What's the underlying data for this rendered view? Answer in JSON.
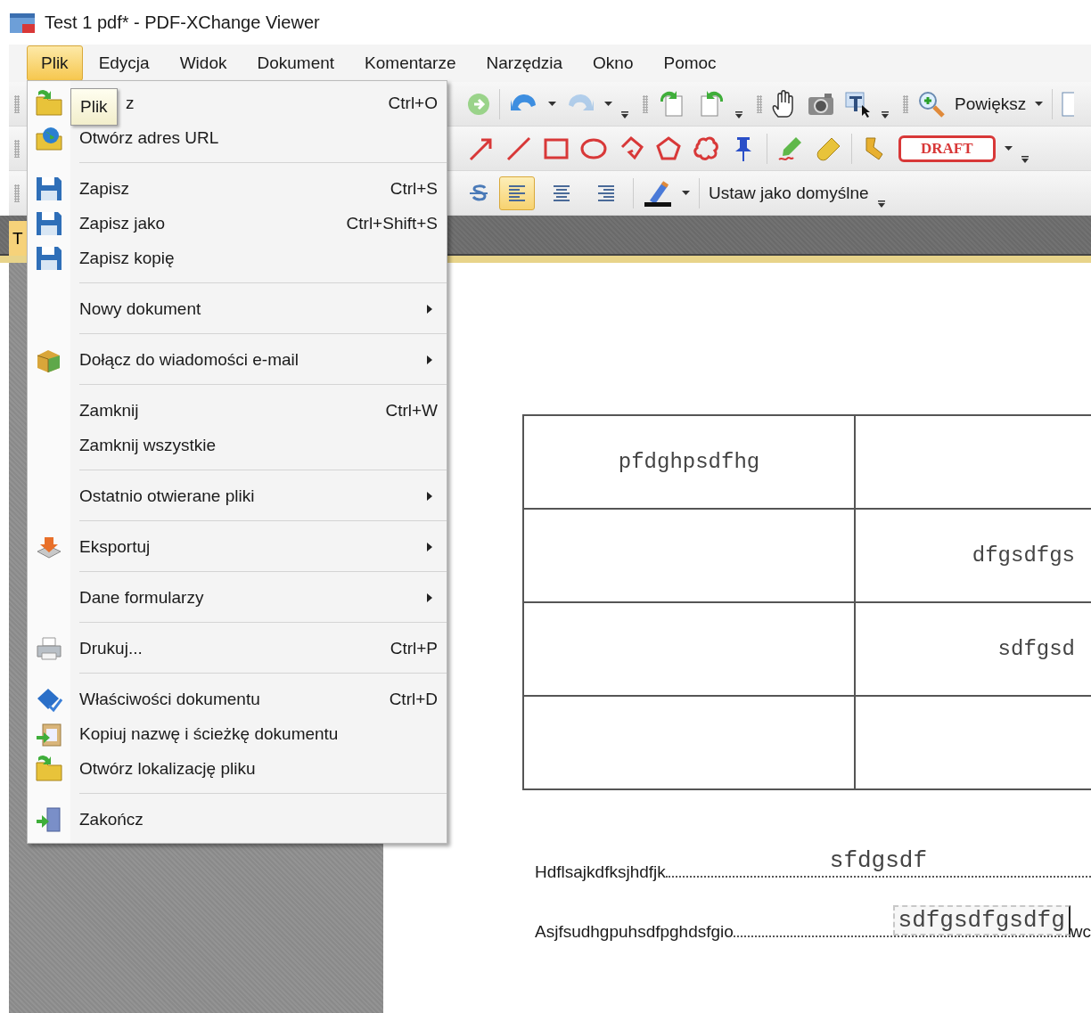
{
  "window": {
    "title": "Test 1 pdf* - PDF-XChange Viewer"
  },
  "menubar": [
    {
      "label": "Plik",
      "selected": true
    },
    {
      "label": "Edycja",
      "selected": false
    },
    {
      "label": "Widok",
      "selected": false
    },
    {
      "label": "Dokument",
      "selected": false
    },
    {
      "label": "Komentarze",
      "selected": false
    },
    {
      "label": "Narzędzia",
      "selected": false
    },
    {
      "label": "Okno",
      "selected": false
    },
    {
      "label": "Pomoc",
      "selected": false
    }
  ],
  "toolbar": {
    "history_buttons": [
      {
        "disabled": false
      },
      {
        "disabled": true
      }
    ],
    "zoom_button": {
      "label": "Powiększ"
    },
    "stamp": {
      "label": "DRAFT"
    },
    "align_buttons": [
      {
        "selected": true
      },
      {
        "selected": false
      },
      {
        "selected": false
      }
    ],
    "set_default_button": {
      "label": "Ustaw jako domyślne"
    }
  },
  "tabs": [
    {
      "label": "T",
      "selected": true
    }
  ],
  "file_menu": {
    "items": [
      {
        "kind": "item",
        "label": "z",
        "shortcut": "Ctrl+O",
        "tooltip": "Plik",
        "submenu": false
      },
      {
        "kind": "item",
        "label": "Otwórz adres URL",
        "submenu": false
      },
      {
        "kind": "separator"
      },
      {
        "kind": "item",
        "label": "Zapisz",
        "shortcut": "Ctrl+S",
        "submenu": false
      },
      {
        "kind": "item",
        "label": "Zapisz jako",
        "shortcut": "Ctrl+Shift+S",
        "submenu": false
      },
      {
        "kind": "item",
        "label": "Zapisz kopię",
        "submenu": false
      },
      {
        "kind": "separator"
      },
      {
        "kind": "item",
        "label": "Nowy dokument",
        "submenu": true
      },
      {
        "kind": "separator"
      },
      {
        "kind": "item",
        "label": "Dołącz do wiadomości e-mail",
        "submenu": true
      },
      {
        "kind": "separator"
      },
      {
        "kind": "item",
        "label": "Zamknij",
        "shortcut": "Ctrl+W",
        "submenu": false
      },
      {
        "kind": "item",
        "label": "Zamknij wszystkie",
        "submenu": false
      },
      {
        "kind": "separator"
      },
      {
        "kind": "item",
        "label": "Ostatnio otwierane pliki",
        "submenu": true
      },
      {
        "kind": "separator"
      },
      {
        "kind": "item",
        "label": "Eksportuj",
        "submenu": true
      },
      {
        "kind": "separator"
      },
      {
        "kind": "item",
        "label": "Dane formularzy",
        "submenu": true
      },
      {
        "kind": "separator"
      },
      {
        "kind": "item",
        "label": "Drukuj...",
        "shortcut": "Ctrl+P",
        "submenu": false
      },
      {
        "kind": "separator"
      },
      {
        "kind": "item",
        "label": "Właściwości dokumentu",
        "shortcut": "Ctrl+D",
        "submenu": false
      },
      {
        "kind": "item",
        "label": "Kopiuj nazwę i ścieżkę dokumentu",
        "submenu": false
      },
      {
        "kind": "item",
        "label": "Otwórz lokalizację pliku",
        "submenu": false
      },
      {
        "kind": "separator"
      },
      {
        "kind": "item",
        "label": "Zakończ",
        "submenu": false
      }
    ]
  },
  "document": {
    "table": {
      "rows": [
        {
          "column_1": "pfdghpsdfhg"
        },
        {
          "column_2": "dfgsdfgs"
        },
        {
          "column_2": "sdfgsd"
        },
        {}
      ]
    },
    "form_lines": [
      {
        "label": "Hdflsajkdfksjhdfjk",
        "value": "sfdgsdf",
        "focused": false
      },
      {
        "label": "Asjfsudhgpuhsdfpghdsfgio",
        "value": "sdfgsdfgsdfg",
        "focused": true,
        "after": "wc"
      }
    ]
  }
}
